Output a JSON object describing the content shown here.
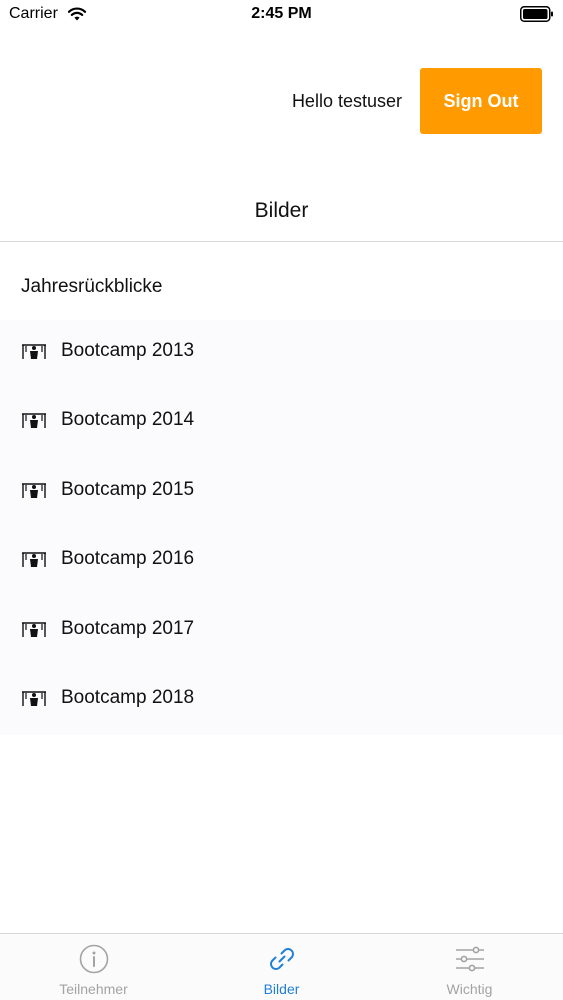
{
  "status_bar": {
    "carrier": "Carrier",
    "time": "2:45 PM"
  },
  "header": {
    "greeting": "Hello testuser",
    "sign_out_label": "Sign Out"
  },
  "page": {
    "title": "Bilder"
  },
  "section": {
    "header": "Jahresrückblicke",
    "items": [
      {
        "label": "Bootcamp 2013",
        "icon": "photo-icon"
      },
      {
        "label": "Bootcamp 2014",
        "icon": "photo-icon"
      },
      {
        "label": "Bootcamp 2015",
        "icon": "photo-icon"
      },
      {
        "label": "Bootcamp 2016",
        "icon": "photo-icon"
      },
      {
        "label": "Bootcamp 2017",
        "icon": "photo-icon"
      },
      {
        "label": "Bootcamp 2018",
        "icon": "photo-icon"
      }
    ]
  },
  "tab_bar": {
    "tabs": [
      {
        "label": "Teilnehmer",
        "icon": "info-icon",
        "active": false
      },
      {
        "label": "Bilder",
        "icon": "link-icon",
        "active": true
      },
      {
        "label": "Wichtig",
        "icon": "sliders-icon",
        "active": false
      }
    ]
  },
  "colors": {
    "accent": "#ff9a00",
    "active_tab": "#1f7fd6",
    "inactive_tab": "#a3a3a3",
    "list_background": "#fbfafd"
  }
}
